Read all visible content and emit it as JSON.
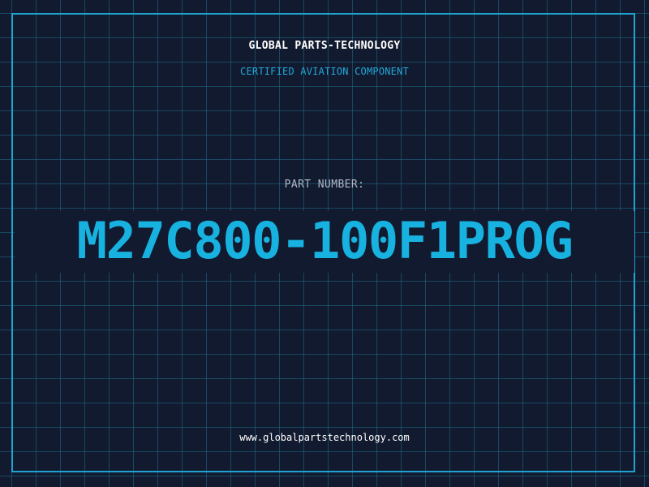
{
  "brand": {
    "name": "GLOBAL PARTS-TECHNOLOGY",
    "tagline": "CERTIFIED AVIATION COMPONENT"
  },
  "part": {
    "label": "PART NUMBER:",
    "number": "M27C800-100F1PROG"
  },
  "footer": {
    "website": "www.globalpartstechnology.com"
  },
  "colors": {
    "background": "#121a2f",
    "grid": "#1e6e8c",
    "frame": "#1fa3d1",
    "accent": "#17b2e0",
    "label": "#aeb8c9",
    "text": "#ffffff"
  }
}
